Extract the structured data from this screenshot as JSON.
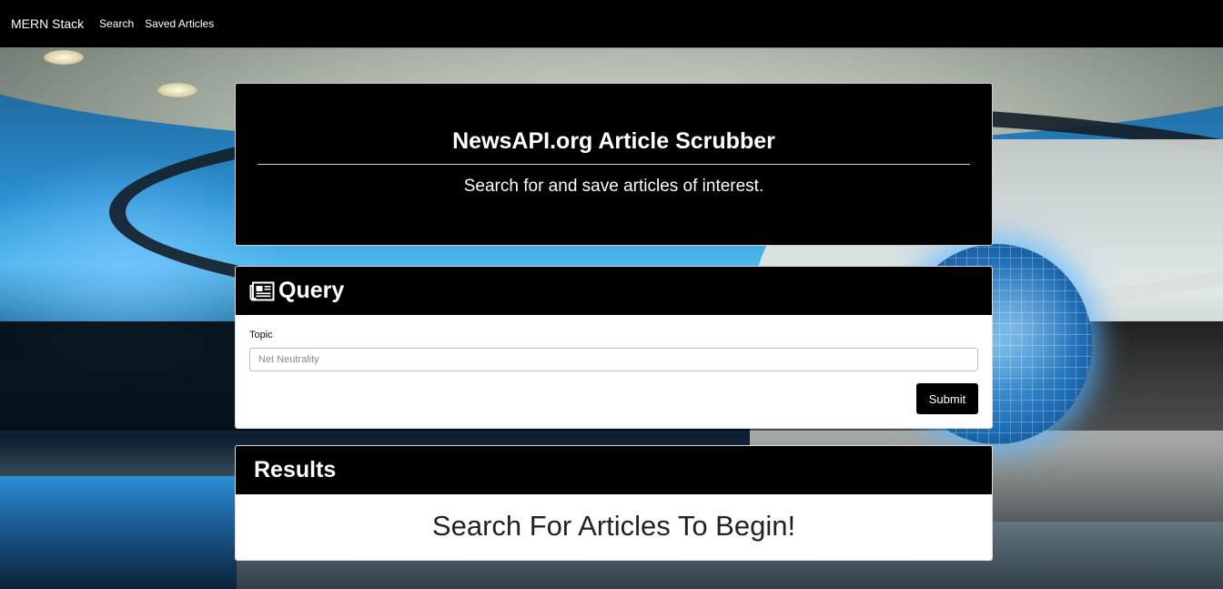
{
  "navbar": {
    "brand": "MERN Stack",
    "links": [
      "Search",
      "Saved Articles"
    ]
  },
  "jumbotron": {
    "title": "NewsAPI.org Article Scrubber",
    "subtitle": "Search for and save articles of interest."
  },
  "query_panel": {
    "title": "Query",
    "icon": "newspaper-icon",
    "topic_label": "Topic",
    "topic_placeholder": "Net Neutrality",
    "topic_value": "",
    "submit_label": "Submit"
  },
  "results_panel": {
    "title": "Results",
    "empty_message": "Search For Articles To Begin!"
  },
  "colors": {
    "panel_header": "#000000",
    "navbar": "#000000",
    "button": "#000000"
  }
}
